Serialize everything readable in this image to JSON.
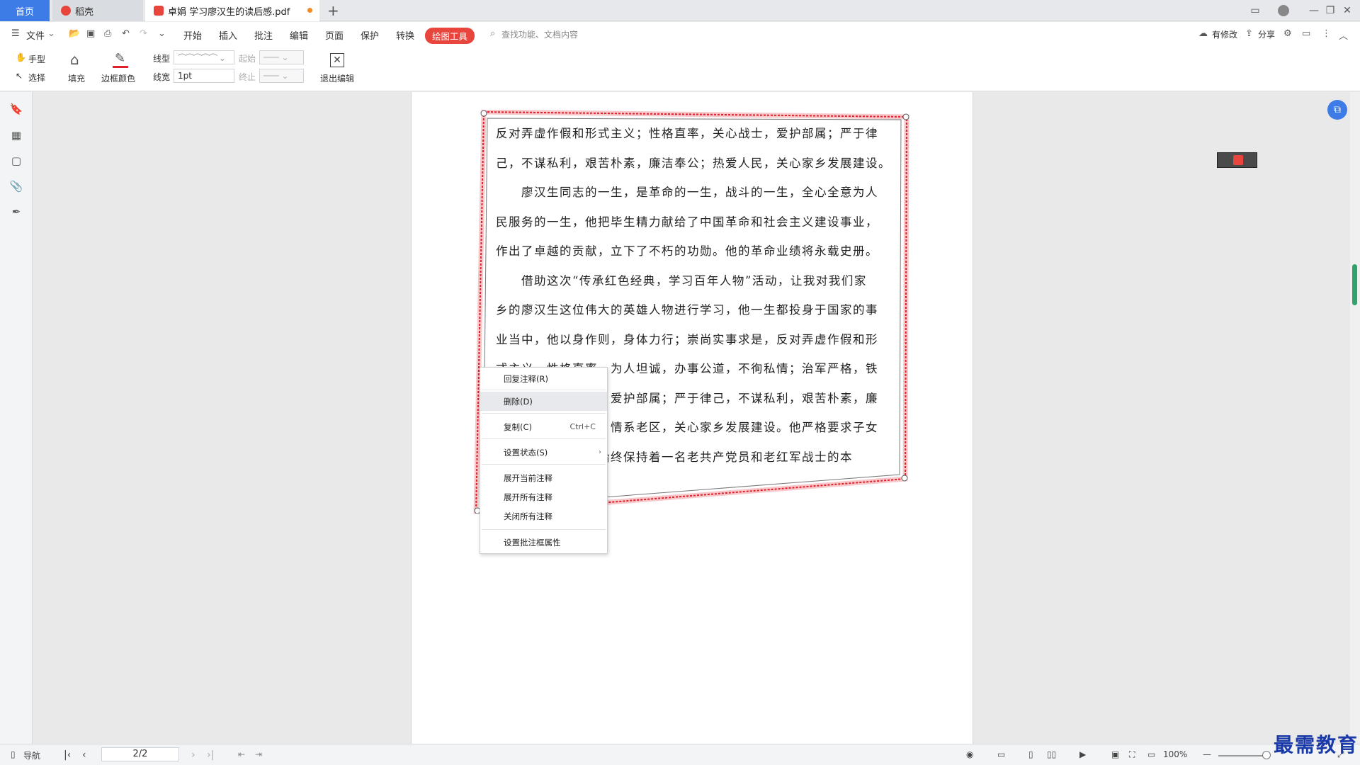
{
  "tabs": [
    {
      "label": "首页"
    },
    {
      "label": "稻壳"
    },
    {
      "label": "卓娟 学习廖汉生的读后感.pdf"
    }
  ],
  "window": {
    "new_tab": "+"
  },
  "menubar": {
    "file": "文件",
    "items": [
      "开始",
      "插入",
      "批注",
      "编辑",
      "页面",
      "保护",
      "转换"
    ],
    "active_tool": "绘图工具",
    "search_placeholder": "查找功能、文档内容",
    "has_changes": "有修改",
    "share": "分享"
  },
  "ribbon": {
    "hand": "手型",
    "select": "选择",
    "fill": "填充",
    "border_color": "边框颜色",
    "line_type": "线型",
    "line_width": "线宽",
    "line_width_value": "1pt",
    "start": "起始",
    "end": "终止",
    "exit_edit": "退出编辑"
  },
  "document": {
    "lines": [
      "反对弄虚作假和形式主义；性格直率，关心战士，爱护部属；严于律",
      "己，不谋私利，艰苦朴素，廉洁奉公；热爱人民，关心家乡发展建设。",
      "廖汉生同志的一生，是革命的一生，战斗的一生，全心全意为人",
      "民服务的一生，他把毕生精力献给了中国革命和社会主义建设事业，",
      "作出了卓越的贡献，立下了不朽的功勋。他的革命业绩将永载史册。",
      "借助这次“传承红色经典，学习百年人物”活动，让我对我们家",
      "乡的廖汉生这位伟大的英雄人物进行学习，他一生都投身于国家的事",
      "业当中，他以身作则，身体力行；崇尚实事求是，反对弄虚作假和形",
      "式主义，性格直率，为人坦诚，办事公道，不徇私情；治军严格，铁",
      "面无私，关心战士，爱护部属；严于律己，不谋私利，艰苦朴素，廉",
      "洁奉公；热爱人民，情系老区，关心家乡发展建设。他严格要求子女",
      "和身边工作人员，始终保持着一名老共产党员和老红军战士的本"
    ]
  },
  "context_menu": {
    "reply": "回复注释(R)",
    "delete": "删除(D)",
    "copy": "复制(C)",
    "copy_shortcut": "Ctrl+C",
    "set_status": "设置状态(S)",
    "expand_current": "展开当前注释",
    "expand_all": "展开所有注释",
    "close_all": "关闭所有注释",
    "set_props": "设置批注框属性"
  },
  "statusbar": {
    "nav": "导航",
    "page": "2/2",
    "zoom": "100%"
  },
  "watermark": "最需教育",
  "colors": {
    "accent": "#3d7be6",
    "annotation": "#e0202a",
    "active_tool": "#e8463d"
  }
}
